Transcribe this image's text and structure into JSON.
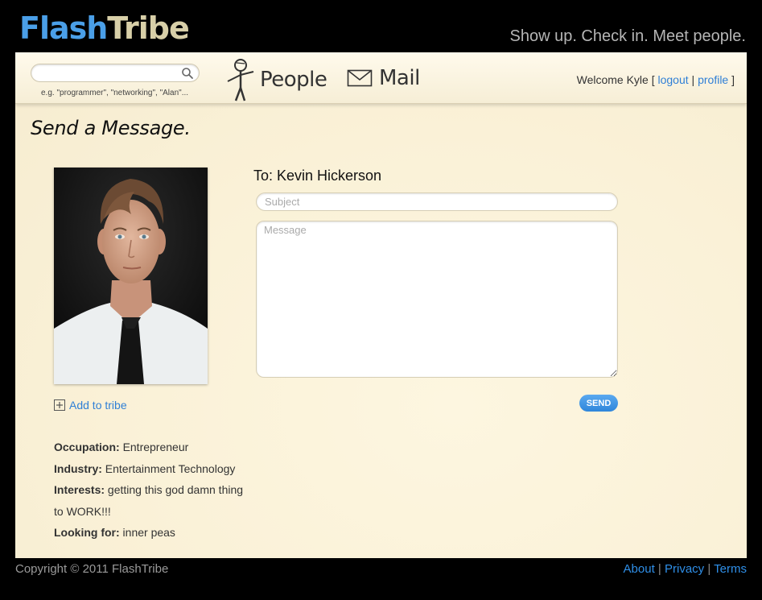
{
  "header": {
    "brand_part1": "Flash",
    "brand_part2": "Tribe",
    "tagline": "Show up. Check in. Meet people."
  },
  "nav": {
    "search_placeholder": "",
    "search_hint": "e.g. \"programmer\", \"networking\", \"Alan\"...",
    "people_label": "People",
    "mail_label": "Mail",
    "welcome_text": "Welcome Kyle",
    "bracket_open": "[",
    "separator": "|",
    "bracket_close": "]",
    "logout_label": "logout",
    "profile_label": "profile"
  },
  "page": {
    "title": "Send a Message."
  },
  "profile": {
    "add_to_tribe_label": "Add to tribe",
    "occupation_label": "Occupation:",
    "occupation": "Entrepreneur",
    "industry_label": "Industry:",
    "industry": "Entertainment Technology",
    "interests_label": "Interests:",
    "interests": "getting this god damn thing to WORK!!!",
    "looking_for_label": "Looking for:",
    "looking_for": "inner peas"
  },
  "compose": {
    "to_line": "To: Kevin Hickerson",
    "subject_placeholder": "Subject",
    "message_placeholder": "Message",
    "send_label": "SEND"
  },
  "footer": {
    "copyright": "Copyright © 2011 FlashTribe",
    "about_label": "About",
    "privacy_label": "Privacy",
    "terms_label": "Terms",
    "separator": "|"
  },
  "colors": {
    "brand_blue": "#4a9fe8",
    "link_blue": "#2f7fd6",
    "panel_cream": "#faf1d7",
    "background": "#000000"
  }
}
